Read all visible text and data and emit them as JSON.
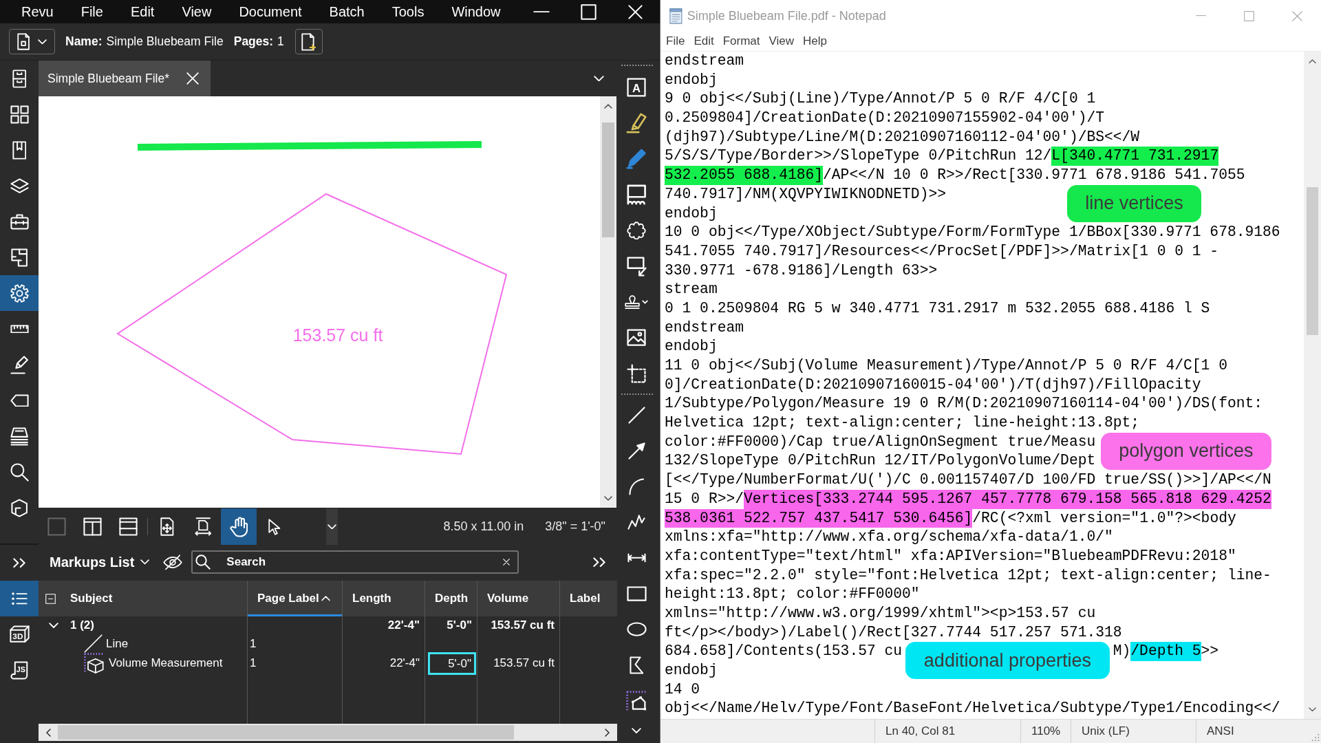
{
  "revu": {
    "menu": [
      "Revu",
      "File",
      "Edit",
      "View",
      "Document",
      "Batch",
      "Tools",
      "Window"
    ],
    "document_info": [
      {
        "label": "Name:",
        "value": "Simple Bluebeam File"
      },
      {
        "label": "Pages:",
        "value": "1"
      }
    ],
    "tabs": [
      {
        "label": "Simple Bluebeam File*",
        "selected": true
      }
    ],
    "left_sidebar": {
      "panels": [
        {
          "selected": false
        },
        {
          "selected": false
        },
        {
          "selected": false
        },
        {
          "selected": false
        },
        {
          "selected": false
        },
        {
          "selected": false
        },
        {
          "selected": true
        },
        {
          "selected": false
        },
        {
          "selected": false
        },
        {
          "selected": false
        },
        {
          "selected": false
        },
        {
          "selected": false
        },
        {
          "selected": false
        }
      ],
      "lower_panels": [
        {
          "selected": true
        },
        {
          "selected": false,
          "icon_text": "3D"
        },
        {
          "selected": false,
          "icon_text": "JS"
        }
      ]
    },
    "canvas": {
      "markups": [
        {
          "kind": "line",
          "color": "#14e84c"
        },
        {
          "kind": "polygon",
          "color": "#f46eea",
          "label": "153.57 cu ft"
        }
      ]
    },
    "view_toolbar": {
      "tools": [
        {
          "selected": false,
          "disabled": true
        },
        {
          "selected": false,
          "disabled": false
        },
        {
          "selected": false,
          "disabled": false
        },
        {
          "selected": false,
          "disabled": false
        },
        {
          "selected": false,
          "disabled": false
        },
        {
          "selected": true,
          "disabled": false
        },
        {
          "selected": false,
          "disabled": false
        }
      ],
      "page_size": "8.50 x 11.00 in",
      "scale": "3/8\" = 1'-0\""
    },
    "markup_tools": {
      "text_box_letter": "A"
    },
    "markups_list": {
      "title": "Markups List",
      "search": {
        "placeholder": "Search"
      },
      "columns": [
        {
          "label": "Subject",
          "sorted": false
        },
        {
          "label": "Page Label",
          "sorted": true
        },
        {
          "label": "Length",
          "sorted": false
        },
        {
          "label": "Depth",
          "sorted": false
        },
        {
          "label": "Volume",
          "sorted": false
        },
        {
          "label": "Label",
          "sorted": false
        }
      ],
      "rows": [
        {
          "subject": "1 (2)",
          "length": {
            "text": "22'-4\"",
            "focused": false
          },
          "depth": {
            "text": "5'-0\"",
            "focused": false
          },
          "volume": {
            "text": "153.57 cu ft",
            "focused": false
          },
          "expanded": true,
          "children": [
            {
              "kind": "line",
              "subject": "Line",
              "page_label": {
                "text": "1",
                "focused": false
              }
            },
            {
              "kind": "volume",
              "subject": "Volume Measurement",
              "page_label": {
                "text": "1",
                "focused": false
              },
              "length": {
                "text": "22'-4\"",
                "focused": false
              },
              "depth": {
                "text": "5'-0\"",
                "focused": true
              },
              "volume": {
                "text": "153.57 cu ft",
                "focused": false
              }
            }
          ]
        }
      ]
    }
  },
  "notepad": {
    "title": "Simple Bluebeam File.pdf - Notepad",
    "menu": [
      "File",
      "Edit",
      "Format",
      "View",
      "Help"
    ],
    "lines": [
      {
        "text": "endstream"
      },
      {
        "text": "endobj"
      },
      {
        "text": "9 0 obj<</Subj(Line)/Type/Annot/P 5 0 R/F 4/C[0 1"
      },
      {
        "text": "0.2509804]/CreationDate(D:20210907155902-04'00')/T"
      },
      {
        "text": "(djh97)/Subtype/Line/M(D:20210907160112-04'00')/BS<</W"
      },
      {
        "segments": [
          {
            "kind": "text",
            "text": "5/S/S/Type/Border>>/SlopeType 0/PitchRun 12/"
          },
          {
            "kind": "mark",
            "text": "L[340.4771 731.2917",
            "color": "#14ee4c"
          }
        ]
      },
      {
        "segments": [
          {
            "kind": "mark",
            "text": "532.2055 688.4186]",
            "color": "#14ee4c"
          },
          {
            "kind": "text",
            "text": "/AP<</N 10 0 R>>/Rect[330.9771 678.9186 541.7055"
          }
        ]
      },
      {
        "segments": [
          {
            "kind": "text",
            "text": "740.7917]/NM(XQVPYIWIKNODNETD)>>"
          },
          {
            "kind": "callout",
            "text": "line vertices",
            "color": "#14e84c"
          }
        ]
      },
      {
        "text": "endobj"
      },
      {
        "text": "10 0 obj<</Type/XObject/Subtype/Form/FormType 1/BBox[330.9771 678.9186"
      },
      {
        "text": "541.7055 740.7917]/Resources<</ProcSet[/PDF]>>/Matrix[1 0 0 1 -"
      },
      {
        "text": "330.9771 -678.9186]/Length 63>>"
      },
      {
        "text": "stream"
      },
      {
        "text": "0 1 0.2509804 RG 5 w 340.4771 731.2917 m 532.2055 688.4186 l S"
      },
      {
        "text": "endstream"
      },
      {
        "text": "endobj"
      },
      {
        "text": "11 0 obj<</Subj(Volume Measurement)/Type/Annot/P 5 0 R/F 4/C[1 0"
      },
      {
        "text": "0]/CreationDate(D:20210907160015-04'00')/T(djh97)/FillOpacity"
      },
      {
        "text": "1/Subtype/Polygon/Measure 19 0 R/M(D:20210907160114-04'00')/DS(font:"
      },
      {
        "text": "Helvetica 12pt; text-align:center; line-height:13.8pt;"
      },
      {
        "segments": [
          {
            "kind": "text",
            "text": "color:#FF0000)/Cap true/AlignOnSegment true/Measu"
          },
          {
            "kind": "callout",
            "text": "polygon vertices",
            "color": "#fb72ea"
          }
        ]
      },
      {
        "text": "132/SlopeType 0/PitchRun 12/IT/PolygonVolume/Dept"
      },
      {
        "text": "[<</Type/NumberFormat/U(')/C 0.001157407/D 100/FD true/SS()>>]/AP<</N"
      },
      {
        "segments": [
          {
            "kind": "text",
            "text": "15 0 R>>/"
          },
          {
            "kind": "mark",
            "text": "Vertices[333.2744 595.1267 457.7778 679.158 565.818 629.4252",
            "color": "#f866ec"
          }
        ]
      },
      {
        "segments": [
          {
            "kind": "mark",
            "text": "538.0361 522.757 437.5417 530.6456]",
            "color": "#f866ec"
          },
          {
            "kind": "text",
            "text": "/RC(<?xml version=\"1.0\"?><body"
          }
        ]
      },
      {
        "text": "xmlns:xfa=\"http://www.xfa.org/schema/xfa-data/1.0/\""
      },
      {
        "text": "xfa:contentType=\"text/html\" xfa:APIVersion=\"BluebeamPDFRevu:2018\""
      },
      {
        "text": "xfa:spec=\"2.2.0\" style=\"font:Helvetica 12pt; text-align:center; line-"
      },
      {
        "text": "height:13.8pt; color:#FF0000\""
      },
      {
        "text": "xmlns=\"http://www.w3.org/1999/xhtml\"><p>153.57 cu"
      },
      {
        "text": "ft</p></body>)/Label()/Rect[327.7744 517.257 571.318"
      },
      {
        "segments": [
          {
            "kind": "text",
            "text": "684.658]/Contents(153.57 cu"
          },
          {
            "kind": "callout",
            "text": "additional properties",
            "color": "#00e6f2"
          },
          {
            "kind": "text",
            "text": "M)"
          },
          {
            "kind": "mark",
            "text": "/Depth 5",
            "color": "#00e6f2"
          },
          {
            "kind": "text",
            "text": ">>"
          }
        ]
      },
      {
        "text": "endobj"
      },
      {
        "text": "14 0"
      },
      {
        "text": "obj<</Name/Helv/Type/Font/BaseFont/Helvetica/Subtype/Type1/Encoding<</"
      }
    ],
    "status_bar": [
      "Ln 40, Col 81",
      "110%",
      "Unix (LF)",
      "ANSI"
    ]
  }
}
